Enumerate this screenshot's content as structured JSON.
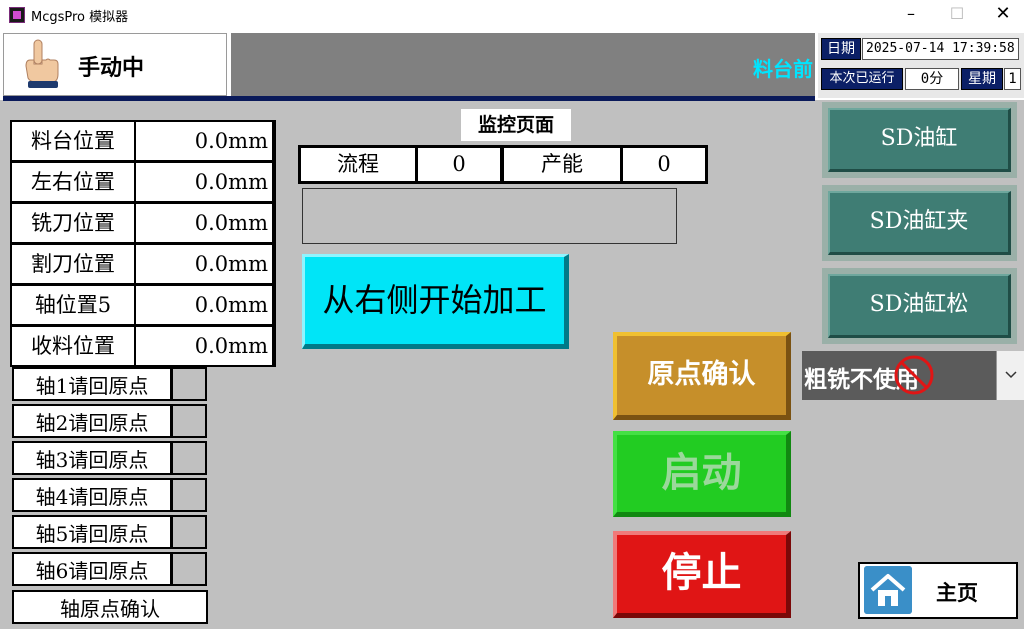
{
  "window": {
    "title": "McgsPro 模拟器",
    "minimize": "–",
    "maximize": "☐",
    "close": "✕"
  },
  "header": {
    "mode": "手动中",
    "marquee": "料台前"
  },
  "info": {
    "date_label": "日期",
    "date_value": "2025-07-14 17:39:58",
    "runtime_label": "本次已运行",
    "runtime_value": "0分",
    "week_label": "星期",
    "week_value": "1"
  },
  "positions": [
    {
      "label": "料台位置",
      "value": "0.0mm"
    },
    {
      "label": "左右位置",
      "value": "0.0mm"
    },
    {
      "label": "铣刀位置",
      "value": "0.0mm"
    },
    {
      "label": "割刀位置",
      "value": "0.0mm"
    },
    {
      "label": "轴位置5",
      "value": "0.0mm"
    },
    {
      "label": "收料位置",
      "value": "0.0mm"
    }
  ],
  "homing": [
    "轴1请回原点",
    "轴2请回原点",
    "轴3请回原点",
    "轴4请回原点",
    "轴5请回原点",
    "轴6请回原点",
    "轴原点确认"
  ],
  "monitor": {
    "title": "监控页面",
    "flow_label": "流程",
    "flow_value": "0",
    "capacity_label": "产能",
    "capacity_value": "0"
  },
  "buttons": {
    "start_right": "从右侧开始加工",
    "sd_cylinder": "SD油缸",
    "sd_clamp": "SD油缸夹",
    "sd_release": "SD油缸松",
    "home_confirm": "原点确认",
    "start": "启动",
    "stop": "停止",
    "main_page": "主页"
  },
  "rough_mill": {
    "text": "粗铣不使用"
  },
  "colors": {
    "background": "#c0c0c0",
    "navy": "#0b1f66",
    "cyan_button": "#00e5f7",
    "teal_button": "#3f7d74",
    "gold_button": "#c68f2a",
    "green_button": "#22cc22",
    "red_button": "#e01515"
  }
}
